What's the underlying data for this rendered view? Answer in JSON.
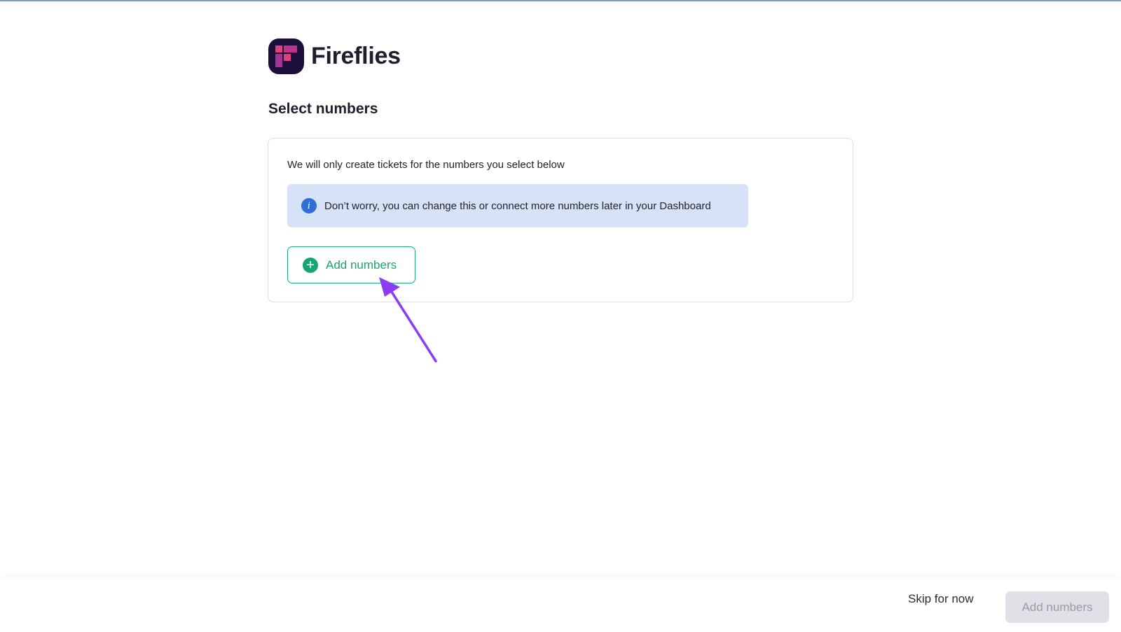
{
  "app": {
    "name": "Fireflies"
  },
  "page": {
    "title": "Select numbers"
  },
  "card": {
    "description": "We will only create tickets for the numbers you select below",
    "info_message": "Don’t worry, you can change this or connect more numbers later in your Dashboard",
    "info_icon": "info-icon",
    "add_button_label": "Add numbers",
    "add_button_icon": "plus-circle-icon"
  },
  "footer": {
    "skip_label": "Skip for now",
    "submit_label": "Add numbers",
    "submit_disabled": true
  },
  "colors": {
    "accent_green": "#17a673",
    "info_bg": "#d6e2f6",
    "info_icon": "#2f6ed8",
    "annotation_arrow": "#8b3df5",
    "logo_bg": "#1b0f3a",
    "logo_pink": "#e0407f"
  }
}
